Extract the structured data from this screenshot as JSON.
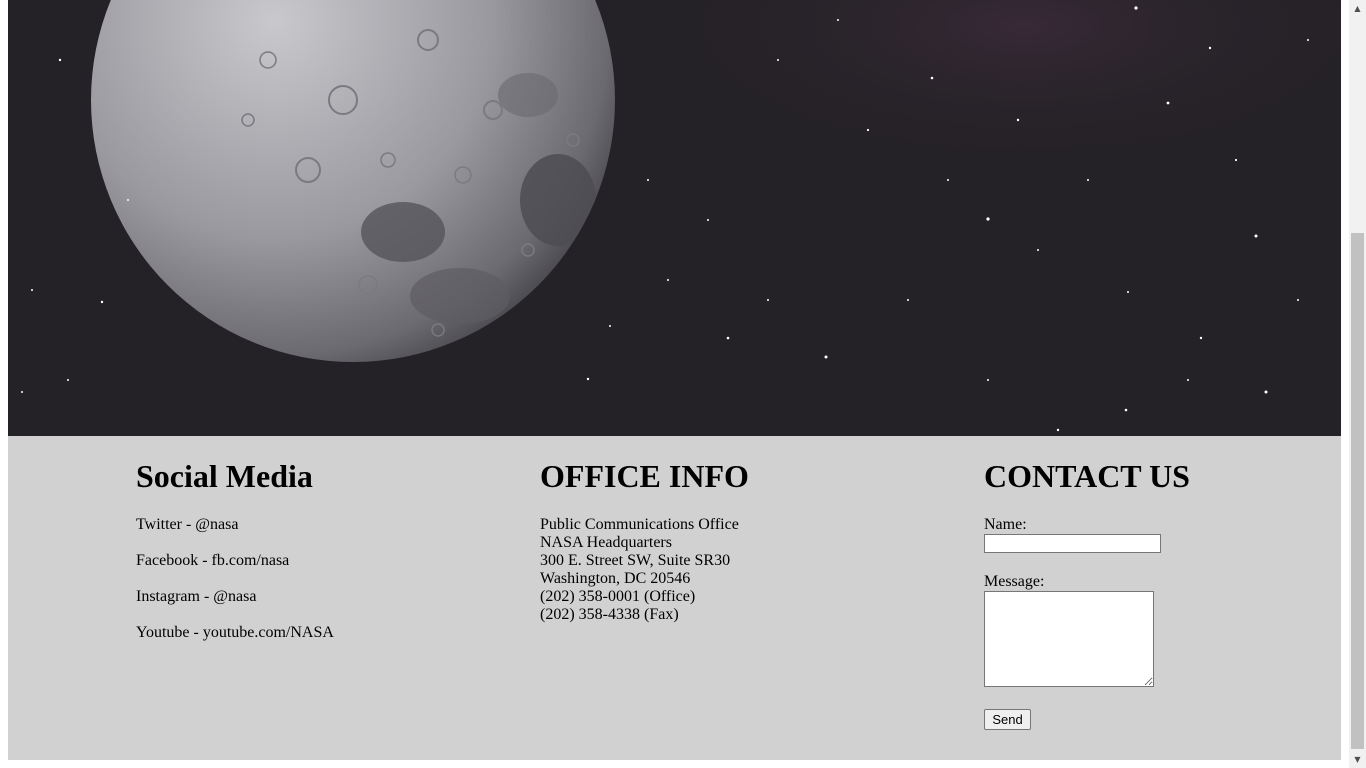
{
  "hero": {
    "image_description": "moon-in-starfield"
  },
  "social": {
    "heading": "Social Media",
    "items": [
      "Twitter - @nasa",
      "Facebook - fb.com/nasa",
      "Instagram - @nasa",
      "Youtube - youtube.com/NASA"
    ]
  },
  "office": {
    "heading": "OFFICE INFO",
    "lines": [
      "Public Communications Office",
      "NASA Headquarters",
      "300 E. Street SW, Suite SR30",
      "Washington, DC 20546",
      "(202) 358-0001 (Office)",
      "(202) 358-4338 (Fax)"
    ]
  },
  "contact": {
    "heading": "CONTACT US",
    "name_label": "Name:",
    "name_value": "",
    "message_label": "Message:",
    "message_value": "",
    "send_label": "Send"
  },
  "colors": {
    "footer_bg": "#d1d1d1",
    "hero_bg": "#252227"
  },
  "icons": {
    "scroll_up": "up-arrow-icon",
    "scroll_down": "down-arrow-icon"
  }
}
